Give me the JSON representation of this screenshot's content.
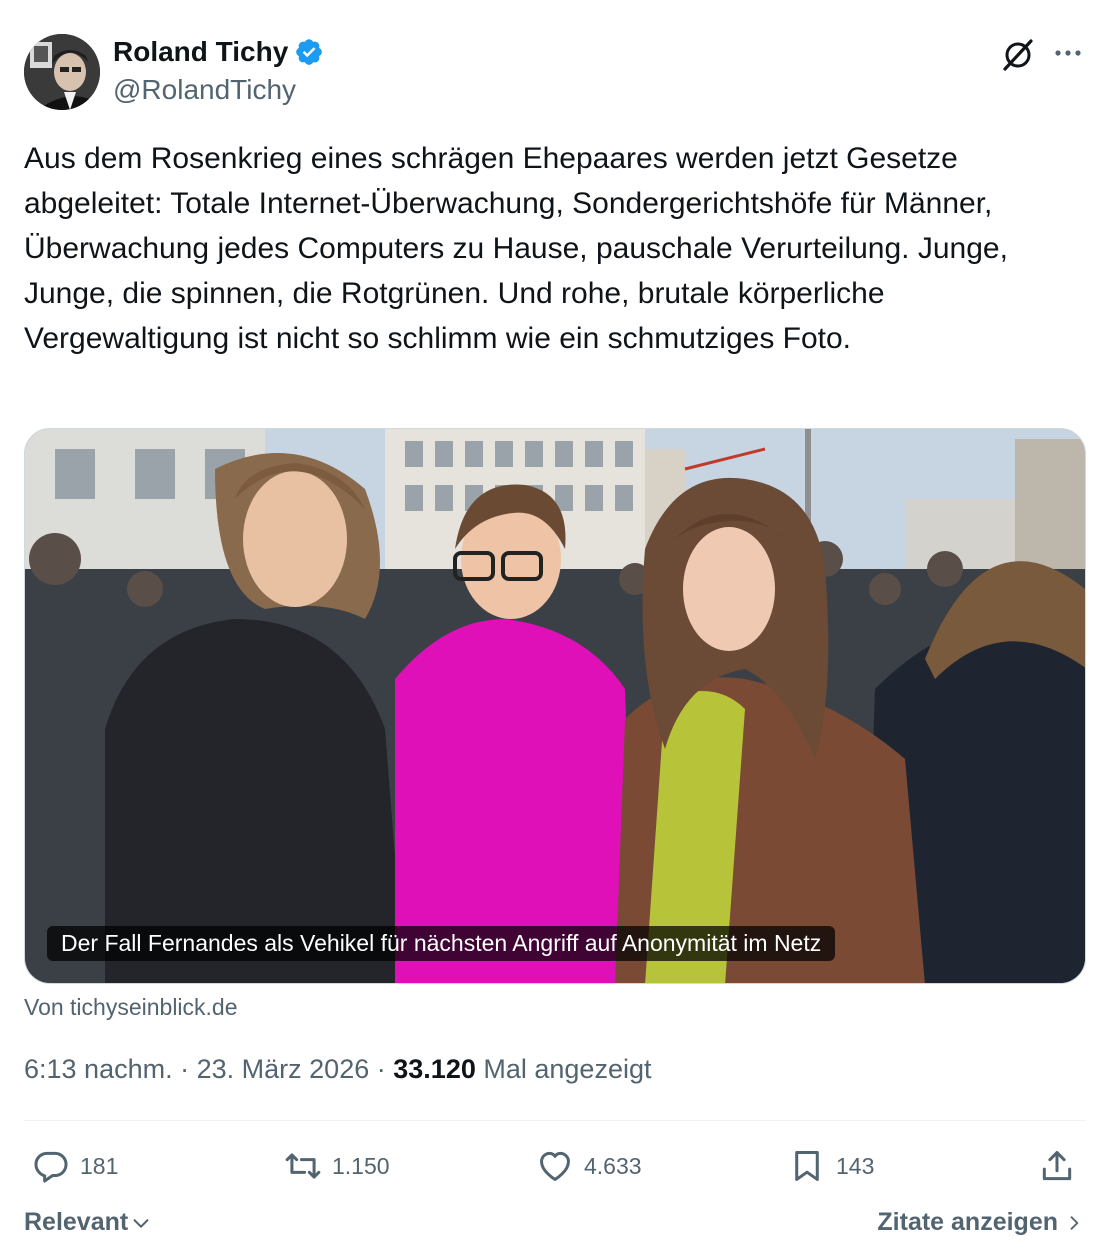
{
  "author": {
    "name": "Roland Tichy",
    "handle": "@RolandTichy",
    "verified": true,
    "verified_color": "#1d9bf0"
  },
  "header_icons": {
    "grok": "grok-icon",
    "more": "more-icon"
  },
  "tweet": {
    "text": "Aus dem Rosenkrieg eines schrägen Ehepaares werden jetzt Gesetze abgeleitet: Totale Internet-Überwachung, Sondergerichtshöfe für Männer, Überwachung jedes Computers zu Hause, pauschale Verurteilung. Junge, Junge, die spinnen, die Rotgrünen. Und rohe, brutale körperliche  Vergewaltigung ist nicht so schlimm wie ein schmutziges Foto."
  },
  "card": {
    "caption": "Der Fall Fernandes als Vehikel für nächsten Angriff auf Anonymität im Netz",
    "source": "Von tichyseinblick.de"
  },
  "meta": {
    "time": "6:13 nachm.",
    "separator": "·",
    "date": "23. März 2026",
    "views": "33.120",
    "views_label": "Mal angezeigt"
  },
  "actions": {
    "reply": {
      "icon": "reply-icon",
      "count": "181"
    },
    "retweet": {
      "icon": "retweet-icon",
      "count": "1.150"
    },
    "like": {
      "icon": "heart-icon",
      "count": "4.633"
    },
    "bookmark": {
      "icon": "bookmark-icon",
      "count": "143"
    },
    "share": {
      "icon": "share-icon"
    }
  },
  "footer": {
    "sort_label": "Relevant",
    "quotes_label": "Zitate anzeigen"
  },
  "colors": {
    "text_primary": "#0f1419",
    "text_secondary": "#536471",
    "divider": "#eff3f4",
    "accent": "#1d9bf0",
    "pink_coat": "#e010b8"
  }
}
